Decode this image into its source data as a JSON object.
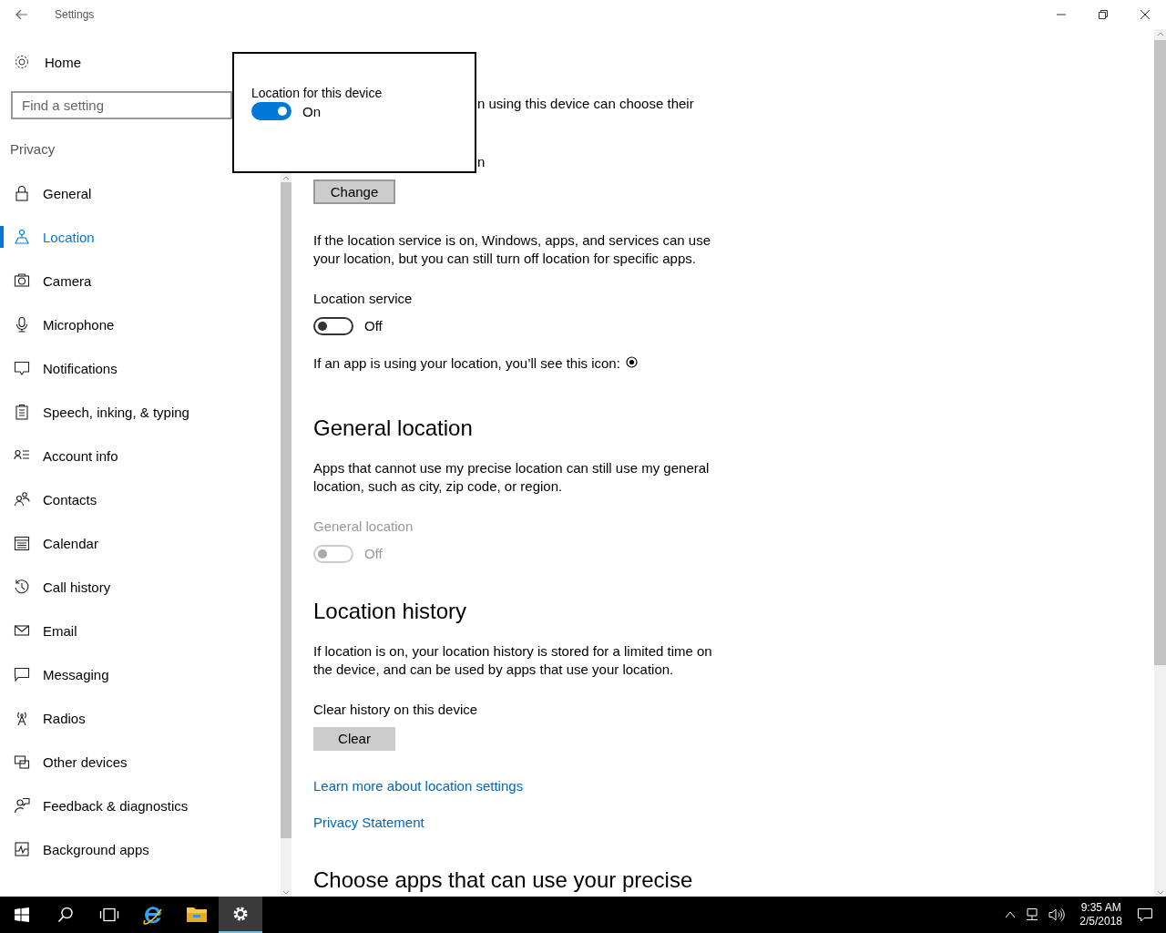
{
  "window": {
    "title": "Settings"
  },
  "sidebar": {
    "home": "Home",
    "search": {
      "placeholder": "Find a setting"
    },
    "section": "Privacy",
    "items": [
      {
        "label": "General",
        "selected": false
      },
      {
        "label": "Location",
        "selected": true
      },
      {
        "label": "Camera",
        "selected": false
      },
      {
        "label": "Microphone",
        "selected": false
      },
      {
        "label": "Notifications",
        "selected": false
      },
      {
        "label": "Speech, inking, & typing",
        "selected": false
      },
      {
        "label": "Account info",
        "selected": false
      },
      {
        "label": "Contacts",
        "selected": false
      },
      {
        "label": "Calendar",
        "selected": false
      },
      {
        "label": "Call history",
        "selected": false
      },
      {
        "label": "Email",
        "selected": false
      },
      {
        "label": "Messaging",
        "selected": false
      },
      {
        "label": "Radios",
        "selected": false
      },
      {
        "label": "Other devices",
        "selected": false
      },
      {
        "label": "Feedback & diagnostics",
        "selected": false
      },
      {
        "label": "Background apps",
        "selected": false
      }
    ]
  },
  "popup": {
    "label": "Location for this device",
    "toggle": {
      "on": true,
      "disabled": false,
      "state_text": "On"
    }
  },
  "content": {
    "fragments": [
      "n using this device can choose their",
      "n"
    ],
    "change_button": "Change",
    "service_description": "If the location service is on, Windows, apps, and services can use your location, but you can still turn off location for specific apps.",
    "location_service": {
      "label": "Location service",
      "on": false,
      "disabled": false,
      "state_text": "Off"
    },
    "icon_note": "If an app is using your location, you’ll see this icon:",
    "general_location": {
      "heading": "General location",
      "description": "Apps that cannot use my precise location can still use my general location, such as city, zip code, or region.",
      "label": "General location",
      "on": false,
      "disabled": true,
      "state_text": "Off"
    },
    "location_history": {
      "heading": "Location history",
      "description": "If location is on, your location history is stored for a limited time on the device, and can be used by apps that use your location.",
      "clear_label": "Clear history on this device",
      "clear_button": "Clear"
    },
    "links": [
      "Learn more about location settings",
      "Privacy Statement"
    ],
    "next_heading": "Choose apps that can use your precise"
  },
  "taskbar": {
    "apps": [
      {
        "kind": "start",
        "selected": false
      },
      {
        "kind": "search",
        "selected": false
      },
      {
        "kind": "taskview",
        "selected": false
      },
      {
        "kind": "browser",
        "selected": false
      },
      {
        "kind": "folder",
        "selected": false
      },
      {
        "kind": "settings",
        "selected": true
      }
    ],
    "time": "9:35 AM",
    "date": "2/5/2018"
  }
}
